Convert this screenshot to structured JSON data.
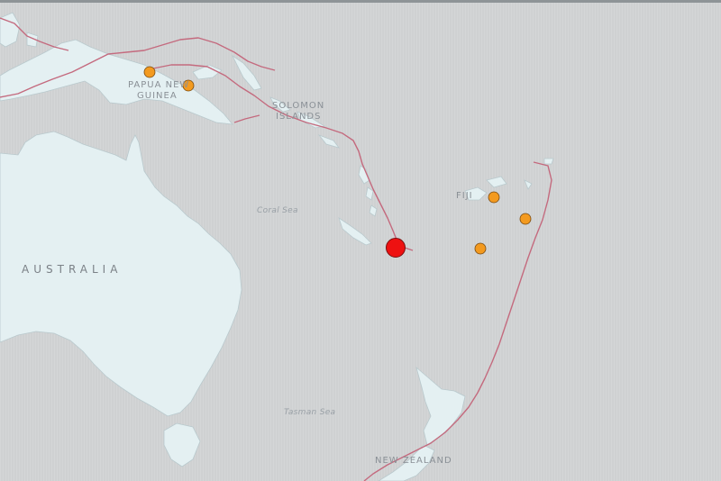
{
  "map": {
    "colors": {
      "ocean": "#cfd1d2",
      "land": "#e4f0f2",
      "plate_boundary": "#c46a7e",
      "mainshock": "#ee1111",
      "aftershock": "#f39a1f"
    },
    "labels": {
      "png_line1": "PAPUA NEW",
      "png_line2": "GUINEA",
      "solomon_line1": "SOLOMON",
      "solomon_line2": "ISLANDS",
      "fiji": "FIJI",
      "australia": "AUSTRALIA",
      "coral_sea": "Coral Sea",
      "tasman_sea": "Tasman Sea",
      "new_zealand": "NEW ZEALAND"
    },
    "earthquakes": [
      {
        "id": "mainshock",
        "size": "large",
        "color": "red"
      },
      {
        "id": "png-1",
        "size": "small",
        "color": "orange"
      },
      {
        "id": "png-2",
        "size": "small",
        "color": "orange"
      },
      {
        "id": "fiji-1",
        "size": "small",
        "color": "orange"
      },
      {
        "id": "fiji-2",
        "size": "small",
        "color": "orange"
      },
      {
        "id": "fiji-3",
        "size": "small",
        "color": "orange"
      }
    ]
  }
}
